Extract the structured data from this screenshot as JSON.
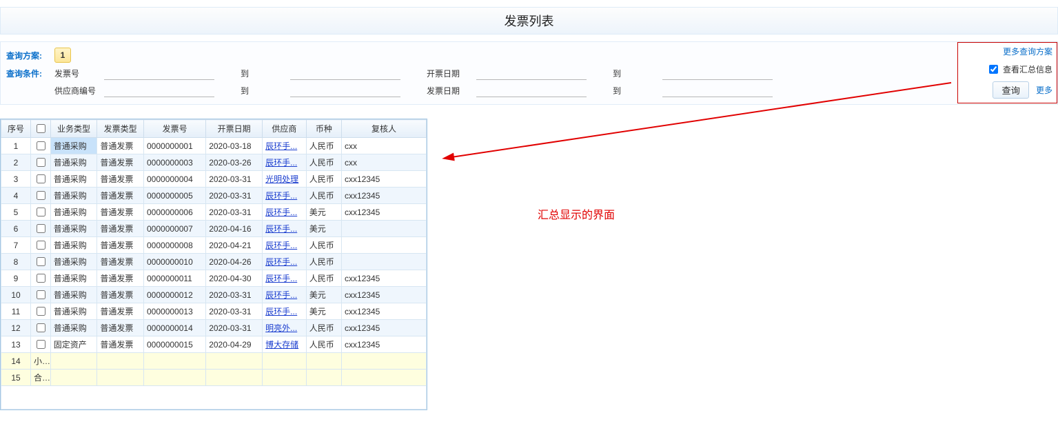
{
  "title": "发票列表",
  "query": {
    "scheme_label": "查询方案:",
    "scheme_number": "1",
    "condition_label": "查询条件:",
    "fields": {
      "invoice_no": "发票号",
      "to": "到",
      "billing_date": "开票日期",
      "supplier_no": "供应商编号",
      "invoice_date": "发票日期"
    }
  },
  "side": {
    "more_schemes": "更多查询方案",
    "view_summary_label": "查看汇总信息",
    "view_summary_checked": true,
    "query_btn": "查询",
    "more": "更多"
  },
  "annotation": "汇总显示的界面",
  "table": {
    "headers": {
      "seq": "序号",
      "biz_type": "业务类型",
      "inv_type": "发票类型",
      "inv_no": "发票号",
      "bill_date": "开票日期",
      "supplier": "供应商",
      "currency": "币种",
      "reviewer": "复核人"
    },
    "subtotal_label": "小计",
    "total_label": "合计",
    "subtotal_seq": "14",
    "total_seq": "15",
    "rows": [
      {
        "seq": "1",
        "biz": "普通采购",
        "invtype": "普通发票",
        "no": "0000000001",
        "date": "2020-03-18",
        "sup": "辰环手...",
        "cur": "人民币",
        "rev": "cxx",
        "sel": true
      },
      {
        "seq": "2",
        "biz": "普通采购",
        "invtype": "普通发票",
        "no": "0000000003",
        "date": "2020-03-26",
        "sup": "辰环手...",
        "cur": "人民币",
        "rev": "cxx"
      },
      {
        "seq": "3",
        "biz": "普通采购",
        "invtype": "普通发票",
        "no": "0000000004",
        "date": "2020-03-31",
        "sup": "光明处理",
        "cur": "人民币",
        "rev": "cxx12345"
      },
      {
        "seq": "4",
        "biz": "普通采购",
        "invtype": "普通发票",
        "no": "0000000005",
        "date": "2020-03-31",
        "sup": "辰环手...",
        "cur": "人民币",
        "rev": "cxx12345"
      },
      {
        "seq": "5",
        "biz": "普通采购",
        "invtype": "普通发票",
        "no": "0000000006",
        "date": "2020-03-31",
        "sup": "辰环手...",
        "cur": "美元",
        "rev": "cxx12345"
      },
      {
        "seq": "6",
        "biz": "普通采购",
        "invtype": "普通发票",
        "no": "0000000007",
        "date": "2020-04-16",
        "sup": "辰环手...",
        "cur": "美元",
        "rev": ""
      },
      {
        "seq": "7",
        "biz": "普通采购",
        "invtype": "普通发票",
        "no": "0000000008",
        "date": "2020-04-21",
        "sup": "辰环手...",
        "cur": "人民币",
        "rev": ""
      },
      {
        "seq": "8",
        "biz": "普通采购",
        "invtype": "普通发票",
        "no": "0000000010",
        "date": "2020-04-26",
        "sup": "辰环手...",
        "cur": "人民币",
        "rev": ""
      },
      {
        "seq": "9",
        "biz": "普通采购",
        "invtype": "普通发票",
        "no": "0000000011",
        "date": "2020-04-30",
        "sup": "辰环手...",
        "cur": "人民币",
        "rev": "cxx12345"
      },
      {
        "seq": "10",
        "biz": "普通采购",
        "invtype": "普通发票",
        "no": "0000000012",
        "date": "2020-03-31",
        "sup": "辰环手...",
        "cur": "美元",
        "rev": "cxx12345"
      },
      {
        "seq": "11",
        "biz": "普通采购",
        "invtype": "普通发票",
        "no": "0000000013",
        "date": "2020-03-31",
        "sup": "辰环手...",
        "cur": "美元",
        "rev": "cxx12345"
      },
      {
        "seq": "12",
        "biz": "普通采购",
        "invtype": "普通发票",
        "no": "0000000014",
        "date": "2020-03-31",
        "sup": "明亮外...",
        "cur": "人民币",
        "rev": "cxx12345"
      },
      {
        "seq": "13",
        "biz": "固定资产",
        "invtype": "普通发票",
        "no": "0000000015",
        "date": "2020-04-29",
        "sup": "博大存储",
        "cur": "人民币",
        "rev": "cxx12345"
      }
    ]
  }
}
